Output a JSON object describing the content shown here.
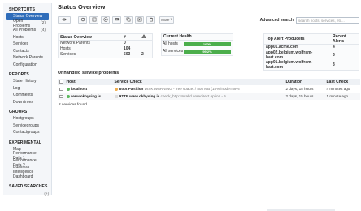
{
  "sidebar": {
    "sections": [
      {
        "title": "SHORTCUTS",
        "items": [
          {
            "label": "Status Overview",
            "count": "",
            "active": true
          },
          {
            "label": "Open Problems",
            "count": "(2)",
            "active": false
          },
          {
            "label": "All Problems",
            "count": "(4)",
            "active": false
          },
          {
            "label": "Hosts",
            "count": "",
            "active": false
          },
          {
            "label": "Services",
            "count": "",
            "active": false
          },
          {
            "label": "Contacts",
            "count": "",
            "active": false
          },
          {
            "label": "Network Parents",
            "count": "",
            "active": false
          },
          {
            "label": "Configuration",
            "count": "",
            "active": false
          }
        ]
      },
      {
        "title": "REPORTS",
        "items": [
          {
            "label": "State History",
            "count": ""
          },
          {
            "label": "Log",
            "count": ""
          },
          {
            "label": "Comments",
            "count": ""
          },
          {
            "label": "Downtimes",
            "count": ""
          }
        ]
      },
      {
        "title": "GROUPS",
        "items": [
          {
            "label": "Hostgroups",
            "count": ""
          },
          {
            "label": "Servicegroups",
            "count": ""
          },
          {
            "label": "Contactgroups",
            "count": ""
          }
        ]
      },
      {
        "title": "EXPERIMENTAL",
        "items": [
          {
            "label": "Map",
            "count": ""
          },
          {
            "label": "Performance Data 1",
            "count": ""
          },
          {
            "label": "Performance Data 2",
            "count": ""
          },
          {
            "label": "Business Intelligence",
            "count": ""
          },
          {
            "label": "Dashboard",
            "count": ""
          }
        ]
      },
      {
        "title": "SAVED SEARCHES",
        "items": []
      }
    ],
    "saved_add": "(+)"
  },
  "main": {
    "title": "Status Overview",
    "toolbar": {
      "more_label": "More"
    },
    "advanced_search": {
      "label": "Advanced search",
      "placeholder": "search hosts, services, etc..."
    },
    "status_overview": {
      "header": "Status Overview",
      "hash": "#",
      "rows": [
        {
          "label": "Network Parents",
          "count": "0",
          "problems": ""
        },
        {
          "label": "Hosts",
          "count": "104",
          "problems": ""
        },
        {
          "label": "Services",
          "count": "503",
          "problems": "2"
        }
      ]
    },
    "current_health": {
      "header": "Current Health",
      "rows": [
        {
          "label": "All hosts",
          "value": "100%"
        },
        {
          "label": "All services",
          "value": "99.2%"
        }
      ]
    },
    "top_alert": {
      "header_producers": "Top Alert Producers",
      "header_alerts": "Recent Alerts",
      "rows": [
        {
          "host": "app01.acme.com",
          "alerts": "4"
        },
        {
          "host": "app02.belgium.wolfram-hart.com",
          "alerts": "3"
        },
        {
          "host": "app01.belgium.wolfram-hart.com",
          "alerts": "3"
        }
      ]
    },
    "problems": {
      "title": "Unhandled service problems",
      "columns": {
        "host": "Host",
        "service": "Service Check",
        "duration": "Duration",
        "last": "Last Check"
      },
      "rows": [
        {
          "host": "localhost",
          "service_name": "Root Partition",
          "service_output": "DISK WARNING - free space: / 805 MB (15% inode=59%",
          "duration": "2 days, 15 hours",
          "last": "4 minutes ago"
        },
        {
          "host": "www.okhysing.is",
          "service_name": "HTTP www.okhysing.is",
          "service_output": "check_http: Invalid onredirect option - 5",
          "duration": "2 days, 15 hours",
          "last": "1 minute ago"
        }
      ],
      "found_text": "2 services found."
    }
  },
  "colors": {
    "accent": "#2f6dba",
    "ok": "#4cae4c",
    "warning": "#f0ad4e"
  }
}
